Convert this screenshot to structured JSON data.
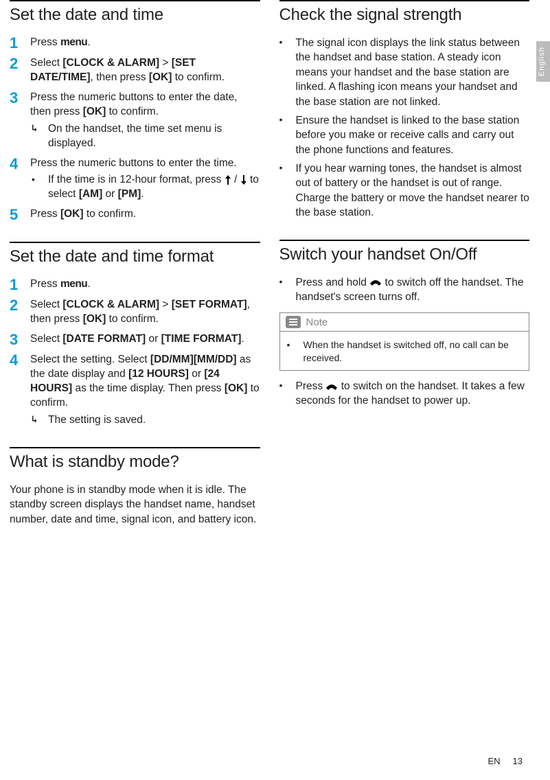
{
  "sidebar": {
    "language": "English"
  },
  "footer": {
    "lang": "EN",
    "page": "13"
  },
  "left": {
    "sec1": {
      "heading": "Set the date and time",
      "items": {
        "1": {
          "pre": "Press ",
          "bold": "menu",
          "post": "."
        },
        "2": {
          "a": "Select ",
          "b": "[CLOCK & ALARM]",
          "c": " > ",
          "d": "[SET DATE/TIME]",
          "e": ", then press ",
          "f": "[OK]",
          "g": " to confirm."
        },
        "3": {
          "a": "Press the numeric buttons to enter the date, then press ",
          "b": "[OK]",
          "c": " to confirm.",
          "sub": "On the handset, the time set menu is displayed."
        },
        "4": {
          "a": "Press the numeric buttons to enter the time.",
          "sub_a": "If the time is in 12-hour format, press ",
          "sub_b": " / ",
          "sub_c": " to select ",
          "sub_d": "[AM]",
          "sub_e": " or ",
          "sub_f": "[PM]",
          "sub_g": "."
        },
        "5": {
          "a": "Press ",
          "b": "[OK]",
          "c": " to confirm."
        }
      }
    },
    "sec2": {
      "heading": "Set the date and time format",
      "items": {
        "1": {
          "pre": "Press ",
          "bold": "menu",
          "post": "."
        },
        "2": {
          "a": "Select ",
          "b": "[CLOCK & ALARM]",
          "c": " > ",
          "d": "[SET FORMAT]",
          "e": ", then press ",
          "f": "[OK]",
          "g": " to confirm."
        },
        "3": {
          "a": "Select ",
          "b": "[DATE FORMAT]",
          "c": " or ",
          "d": "[TIME FORMAT]",
          "e": "."
        },
        "4": {
          "a": "Select the setting. Select ",
          "b": "[DD/MM][MM/DD]",
          "c": " as the date display and ",
          "d": "[12 HOURS]",
          "e": " or ",
          "f": "[24 HOURS]",
          "g": " as the time display. Then press ",
          "h": "[OK]",
          "i": " to confirm.",
          "sub": "The setting is saved."
        }
      }
    },
    "sec3": {
      "heading": "What is standby mode?",
      "para": "Your phone is in standby mode when it is idle. The standby screen displays the handset name, handset number, date and time, signal icon, and battery icon."
    }
  },
  "right": {
    "sec1": {
      "heading": "Check the signal strength",
      "bullets": [
        "The signal icon displays the link status between the handset and base station. A steady icon means your handset and the base station are linked. A flashing icon means your handset and the base station are not linked.",
        "Ensure the handset is linked to the base station before you make or receive calls and carry out the phone functions and features.",
        "If you hear warning tones, the handset is almost out of battery or the handset is out of range. Charge the battery or move the handset nearer to the base station."
      ]
    },
    "sec2": {
      "heading": "Switch your handset On/Off",
      "bullet1_a": "Press and hold ",
      "bullet1_b": " to switch off the handset. The handset's screen turns off.",
      "note_label": "Note",
      "note_body": "When the handset is switched off, no call can be received.",
      "bullet2_a": "Press ",
      "bullet2_b": " to switch on the handset. It takes a few seconds for the handset to power up."
    }
  }
}
